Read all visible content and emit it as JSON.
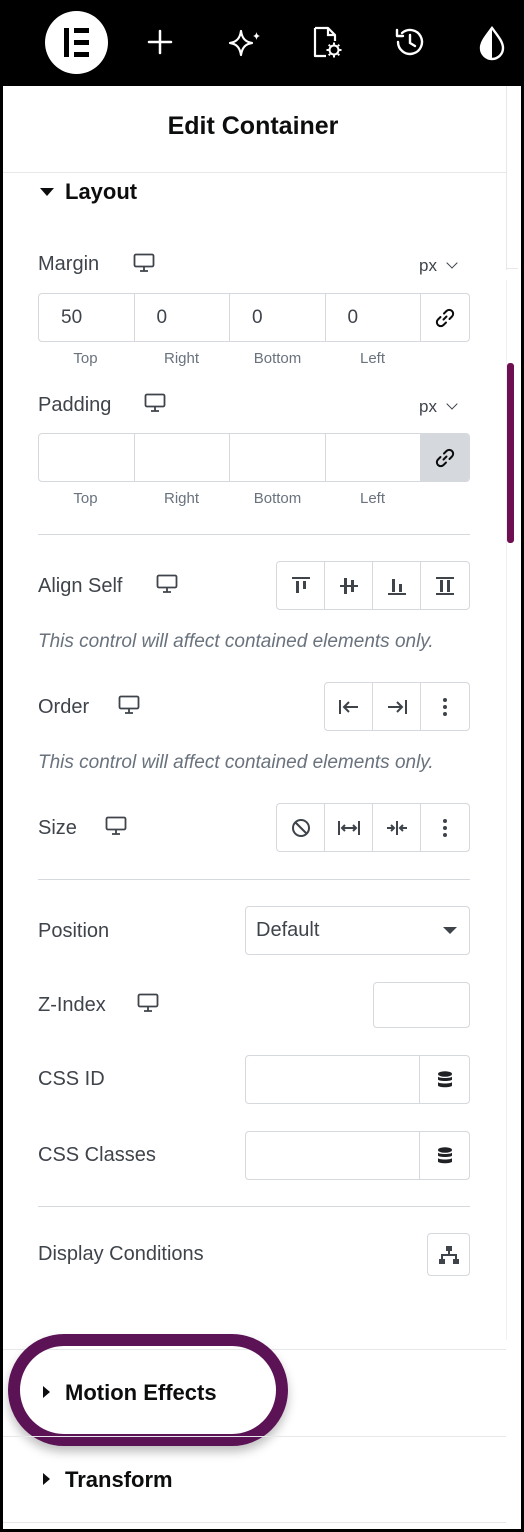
{
  "toolbar": {
    "logo": "elementor-logo-icon",
    "icons": [
      "plus-icon",
      "sparkle-icon",
      "page-settings-icon",
      "history-icon",
      "droplet-icon"
    ]
  },
  "panel": {
    "title": "Edit Container"
  },
  "layout": {
    "title": "Layout",
    "margin": {
      "label": "Margin",
      "unit": "px",
      "values": {
        "top": "50",
        "right": "0",
        "bottom": "0",
        "left": "0"
      },
      "captions": {
        "top": "Top",
        "right": "Right",
        "bottom": "Bottom",
        "left": "Left"
      }
    },
    "padding": {
      "label": "Padding",
      "unit": "px",
      "values": {
        "top": "",
        "right": "",
        "bottom": "",
        "left": ""
      },
      "captions": {
        "top": "Top",
        "right": "Right",
        "bottom": "Bottom",
        "left": "Left"
      }
    },
    "align_self": {
      "label": "Align Self",
      "hint": "This control will affect contained elements only."
    },
    "order": {
      "label": "Order",
      "hint": "This control will affect contained elements only."
    },
    "size": {
      "label": "Size"
    },
    "position": {
      "label": "Position",
      "value": "Default"
    },
    "z_index": {
      "label": "Z-Index",
      "value": ""
    },
    "css_id": {
      "label": "CSS ID",
      "value": ""
    },
    "css_classes": {
      "label": "CSS Classes",
      "value": ""
    },
    "display_conditions": {
      "label": "Display Conditions"
    }
  },
  "sections": {
    "motion_effects": "Motion Effects",
    "transform": "Transform"
  },
  "colors": {
    "accent": "#6e0f52",
    "highlight": "#5b1355"
  }
}
